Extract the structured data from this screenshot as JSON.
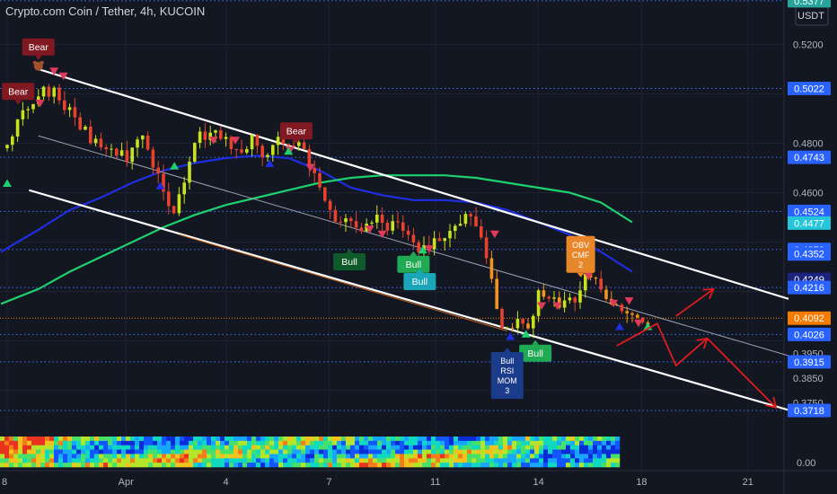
{
  "header": {
    "title": "Crypto.com Coin / Tether, 4h, KUCOIN"
  },
  "currency_label": "USDT",
  "colors": {
    "background": "#131722",
    "up": "#c8e31e",
    "down": "#e8412c",
    "orange": "#f7931a",
    "ma_fast": "#1f2ee0",
    "ma_slow": "#1fd06e",
    "trendline": "#ffffff",
    "arrow": "#e01b1b"
  },
  "chart_data": {
    "type": "candlestick",
    "title": "Crypto.com Coin / Tether, 4h, KUCOIN",
    "xlabel": "",
    "ylabel": "",
    "ylim": [
      0.362,
      0.538
    ],
    "x_tick_labels": [
      "8",
      "Apr",
      "4",
      "7",
      "11",
      "14",
      "18",
      "21"
    ],
    "y_tick_labels": [
      {
        "value": 0.52,
        "label": "0.5200"
      },
      {
        "value": 0.48,
        "label": "0.4800"
      },
      {
        "value": 0.46,
        "label": "0.4600"
      },
      {
        "value": 0.395,
        "label": "0.3950"
      },
      {
        "value": 0.385,
        "label": "0.3850"
      },
      {
        "value": 0.375,
        "label": "0.3750"
      }
    ],
    "price_badges": [
      {
        "value": 0.5377,
        "label": "0.5377",
        "color": "#26a69a"
      },
      {
        "value": 0.5022,
        "label": "0.5022",
        "color": "#2962ff"
      },
      {
        "value": 0.4743,
        "label": "0.4743",
        "color": "#2962ff"
      },
      {
        "value": 0.4524,
        "label": "0.4524",
        "color": "#2962ff"
      },
      {
        "value": 0.4477,
        "label": "0.4477",
        "color": "#26c6da"
      },
      {
        "value": 0.437,
        "label": "0.4370",
        "color": "#2962ff"
      },
      {
        "value": 0.4352,
        "label": "0.4352",
        "color": "#2962ff"
      },
      {
        "value": 0.4249,
        "label": "0.4249",
        "color": "#1a237e"
      },
      {
        "value": 0.4216,
        "label": "0.4216",
        "color": "#2962ff"
      },
      {
        "value": 0.4092,
        "label": "0.4092",
        "color": "#f57c00"
      },
      {
        "value": 0.4026,
        "label": "0.4026",
        "color": "#2962ff"
      },
      {
        "value": 0.3915,
        "label": "0.3915",
        "color": "#2962ff"
      },
      {
        "value": 0.3718,
        "label": "0.3718",
        "color": "#2962ff"
      }
    ],
    "dotted_levels": [
      0.5377,
      0.5022,
      0.4743,
      0.4524,
      0.437,
      0.4216,
      0.4026,
      0.3915,
      0.3718
    ],
    "current_price": 0.4092,
    "price_path": [
      [
        0,
        0.478
      ],
      [
        0.4,
        0.49
      ],
      [
        1,
        0.501
      ],
      [
        1.5,
        0.5
      ],
      [
        2,
        0.492
      ],
      [
        2.5,
        0.484
      ],
      [
        3,
        0.479
      ],
      [
        3.4,
        0.476
      ],
      [
        3.8,
        0.474
      ],
      [
        4.3,
        0.481
      ],
      [
        4.6,
        0.474
      ],
      [
        5.1,
        0.459
      ],
      [
        5.35,
        0.452
      ],
      [
        5.7,
        0.468
      ],
      [
        6,
        0.481
      ],
      [
        6.5,
        0.485
      ],
      [
        7,
        0.482
      ],
      [
        7.4,
        0.478
      ],
      [
        7.8,
        0.481
      ],
      [
        8.3,
        0.476
      ],
      [
        8.7,
        0.481
      ],
      [
        9.3,
        0.478
      ],
      [
        9.8,
        0.47
      ],
      [
        10.1,
        0.462
      ],
      [
        10.4,
        0.448
      ],
      [
        10.7,
        0.446
      ],
      [
        11,
        0.45
      ],
      [
        11.4,
        0.446
      ],
      [
        11.8,
        0.449
      ],
      [
        12.2,
        0.443
      ],
      [
        12.4,
        0.451
      ],
      [
        12.7,
        0.445
      ],
      [
        13.1,
        0.438
      ],
      [
        13.6,
        0.44
      ],
      [
        14,
        0.442
      ],
      [
        14.4,
        0.446
      ],
      [
        14.7,
        0.451
      ],
      [
        15.1,
        0.447
      ],
      [
        15.4,
        0.43
      ],
      [
        15.7,
        0.412
      ],
      [
        15.95,
        0.405
      ],
      [
        16.3,
        0.41
      ],
      [
        16.7,
        0.405
      ],
      [
        17,
        0.418
      ],
      [
        17.4,
        0.418
      ],
      [
        17.8,
        0.414
      ],
      [
        18.1,
        0.417
      ],
      [
        18.4,
        0.423
      ],
      [
        18.7,
        0.428
      ],
      [
        19,
        0.42
      ],
      [
        19.3,
        0.412
      ],
      [
        19.7,
        0.413
      ],
      [
        20.1,
        0.411
      ],
      [
        20.5,
        0.409
      ]
    ],
    "overlay_series": [
      {
        "kind": "moving-average",
        "color": "#1f2ee0",
        "points": [
          [
            -0.2,
            0.436
          ],
          [
            1,
            0.445
          ],
          [
            2,
            0.453
          ],
          [
            3,
            0.458
          ],
          [
            4,
            0.464
          ],
          [
            5,
            0.469
          ],
          [
            6,
            0.472
          ],
          [
            7,
            0.474
          ],
          [
            8,
            0.475
          ],
          [
            9,
            0.474
          ],
          [
            10,
            0.469
          ],
          [
            11,
            0.462
          ],
          [
            12,
            0.459
          ],
          [
            13,
            0.457
          ],
          [
            14,
            0.457
          ],
          [
            15,
            0.456
          ],
          [
            16,
            0.453
          ],
          [
            17,
            0.448
          ],
          [
            18,
            0.443
          ],
          [
            19,
            0.436
          ],
          [
            20,
            0.428
          ]
        ]
      },
      {
        "kind": "moving-average",
        "color": "#1fd06e",
        "points": [
          [
            -0.2,
            0.415
          ],
          [
            1,
            0.421
          ],
          [
            2,
            0.428
          ],
          [
            3,
            0.434
          ],
          [
            4,
            0.44
          ],
          [
            5,
            0.446
          ],
          [
            6,
            0.451
          ],
          [
            7,
            0.455
          ],
          [
            8,
            0.458
          ],
          [
            9,
            0.461
          ],
          [
            10,
            0.464
          ],
          [
            11,
            0.466
          ],
          [
            12,
            0.467
          ],
          [
            13,
            0.467
          ],
          [
            14,
            0.467
          ],
          [
            15,
            0.466
          ],
          [
            16,
            0.464
          ],
          [
            17,
            0.462
          ],
          [
            18,
            0.46
          ],
          [
            19,
            0.456
          ],
          [
            20,
            0.448
          ]
        ]
      }
    ],
    "channel_lines": [
      {
        "kind": "upper-trendline",
        "color": "#ffffff",
        "from": [
          1,
          0.51
        ],
        "to": [
          25,
          0.417
        ]
      },
      {
        "kind": "lower-trendline",
        "color": "#ffffff",
        "from": [
          0.7,
          0.461
        ],
        "to": [
          25,
          0.372
        ]
      },
      {
        "kind": "median-line",
        "color": "#9aa0ad",
        "from": [
          1,
          0.483
        ],
        "to": [
          25,
          0.394
        ]
      },
      {
        "kind": "orange-line",
        "color": "#c0601a",
        "from": [
          5.5,
          0.443
        ],
        "to": [
          16,
          0.404
        ]
      }
    ],
    "projection_arrows": [
      {
        "color": "#e01b1b",
        "points": [
          [
            19.5,
            0.398
          ],
          [
            20.8,
            0.407
          ],
          [
            21.4,
            0.39
          ],
          [
            22.4,
            0.401
          ]
        ]
      },
      {
        "color": "#e01b1b",
        "points": [
          [
            21.4,
            0.41
          ],
          [
            22.6,
            0.421
          ]
        ]
      },
      {
        "color": "#e01b1b",
        "points": [
          [
            22.4,
            0.401
          ],
          [
            24.6,
            0.373
          ]
        ]
      }
    ],
    "annotations": [
      {
        "text": "Bear",
        "kind": "bear",
        "x": 1.0,
        "value": 0.519,
        "emoji": "bear"
      },
      {
        "text": "Bear",
        "kind": "bear",
        "x": 0.35,
        "value": 0.501
      },
      {
        "text": "Bear",
        "kind": "bear",
        "x": 9.25,
        "value": 0.485
      },
      {
        "text": "Bull",
        "kind": "bull-dark",
        "x": 10.95,
        "value": 0.432
      },
      {
        "text": "Bull",
        "kind": "bull",
        "x": 13.0,
        "value": 0.431
      },
      {
        "text": "Bull",
        "kind": "bull-cyan",
        "x": 13.2,
        "value": 0.424
      },
      {
        "text": "Bull",
        "kind": "bull",
        "x": 16.9,
        "value": 0.395
      },
      {
        "text": "OBV\nCMF\n2",
        "kind": "signal-orange",
        "x": 18.35,
        "value": 0.435
      },
      {
        "text": "Bull\nRSI\nMOM\n3",
        "kind": "signal-blue",
        "x": 16.0,
        "value": 0.386
      }
    ],
    "triangle_markers": [
      {
        "dir": "down",
        "color": "#e03a5a",
        "x": 1.5,
        "value": 0.509
      },
      {
        "dir": "down",
        "color": "#e03a5a",
        "x": 1.8,
        "value": 0.507
      },
      {
        "dir": "down",
        "color": "#e03a5a",
        "x": 1.05,
        "value": 0.496
      },
      {
        "dir": "up",
        "color": "#1fd06e",
        "x": 0.0,
        "value": 0.464
      },
      {
        "dir": "up",
        "color": "#1fd06e",
        "x": 5.35,
        "value": 0.471
      },
      {
        "dir": "up",
        "color": "#1f2ee0",
        "x": 4.9,
        "value": 0.463
      },
      {
        "dir": "down",
        "color": "#e03a5a",
        "x": 6.6,
        "value": 0.481
      },
      {
        "dir": "down",
        "color": "#e03a5a",
        "x": 7.3,
        "value": 0.481
      },
      {
        "dir": "down",
        "color": "#e03a5a",
        "x": 9.05,
        "value": 0.477
      },
      {
        "dir": "up",
        "color": "#1fd06e",
        "x": 9.0,
        "value": 0.477
      },
      {
        "dir": "up",
        "color": "#1f2ee0",
        "x": 8.4,
        "value": 0.472
      },
      {
        "dir": "down",
        "color": "#e03a5a",
        "x": 9.7,
        "value": 0.47
      },
      {
        "dir": "down",
        "color": "#e03a5a",
        "x": 11.6,
        "value": 0.445
      },
      {
        "dir": "down",
        "color": "#e03a5a",
        "x": 12.0,
        "value": 0.443
      },
      {
        "dir": "down",
        "color": "#e03a5a",
        "x": 13.5,
        "value": 0.437
      },
      {
        "dir": "up",
        "color": "#1fd06e",
        "x": 13.3,
        "value": 0.437
      },
      {
        "dir": "down",
        "color": "#e03a5a",
        "x": 15.6,
        "value": 0.443
      },
      {
        "dir": "up",
        "color": "#1f2ee0",
        "x": 16.1,
        "value": 0.402
      },
      {
        "dir": "up",
        "color": "#1fd06e",
        "x": 16.6,
        "value": 0.403
      },
      {
        "dir": "down",
        "color": "#e03a5a",
        "x": 17.1,
        "value": 0.414
      },
      {
        "dir": "down",
        "color": "#e03a5a",
        "x": 17.6,
        "value": 0.414
      },
      {
        "dir": "down",
        "color": "#e03a5a",
        "x": 18.6,
        "value": 0.426
      },
      {
        "dir": "down",
        "color": "#e03a5a",
        "x": 19.4,
        "value": 0.415
      },
      {
        "dir": "down",
        "color": "#e03a5a",
        "x": 19.9,
        "value": 0.416
      },
      {
        "dir": "up",
        "color": "#1f2ee0",
        "x": 19.6,
        "value": 0.406
      },
      {
        "dir": "down",
        "color": "#e03a5a",
        "x": 20.2,
        "value": 0.407
      },
      {
        "dir": "up",
        "color": "#1fd06e",
        "x": 20.5,
        "value": 0.406
      }
    ],
    "indicator_panel": {
      "label": "0.00",
      "bands": 7
    }
  }
}
